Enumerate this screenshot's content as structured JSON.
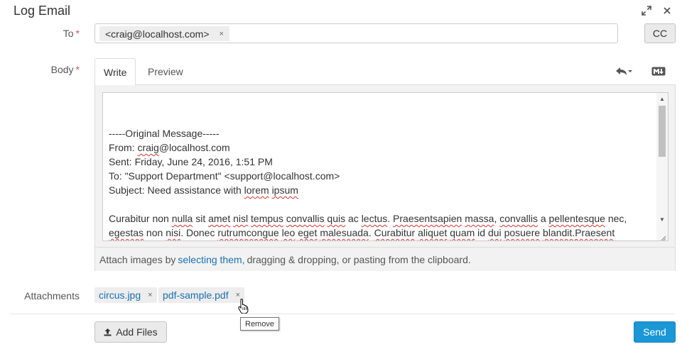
{
  "dialog": {
    "title": "Log Email"
  },
  "to": {
    "label": "To",
    "required_mark": "*",
    "recipients": [
      "<craig@localhost.com>"
    ],
    "remove_glyph": "×",
    "cc_label": "CC"
  },
  "body": {
    "label": "Body",
    "required_mark": "*",
    "tabs": [
      "Write",
      "Preview"
    ],
    "active_tab": "Write",
    "toolbar_icons": [
      "reply-menu-icon",
      "markdown-icon"
    ],
    "lines": [
      "-----Original Message-----",
      "From: craig@localhost.com",
      "Sent: Friday, June 24, 2016, 1:51 PM",
      "To: \"Support Department\" <support@localhost.com>",
      "Subject: Need assistance with lorem ipsum",
      "",
      "Curabitur non nulla sit amet nisl tempus convallis quis ac lectus. Praesentsapien massa, convallis a pellentesque nec,",
      "egestas non nisi. Donec rutrumcongue leo eget malesuada. Curabitur aliquet quam id dui posuere blandit.Praesent"
    ],
    "attach_hint": {
      "before": "Attach images by",
      "link": "selecting them,",
      "after": "dragging & dropping, or pasting from the clipboard."
    }
  },
  "attachments": {
    "label": "Attachments",
    "files": [
      "circus.jpg",
      "pdf-sample.pdf"
    ],
    "remove_glyph": "×",
    "tooltip": "Remove"
  },
  "footer": {
    "add_files_label": "Add Files",
    "send_label": "Send"
  },
  "colors": {
    "primary": "#1997d6",
    "link": "#1a6fb5",
    "required": "#d9534f",
    "spell_error": "#e03030"
  }
}
